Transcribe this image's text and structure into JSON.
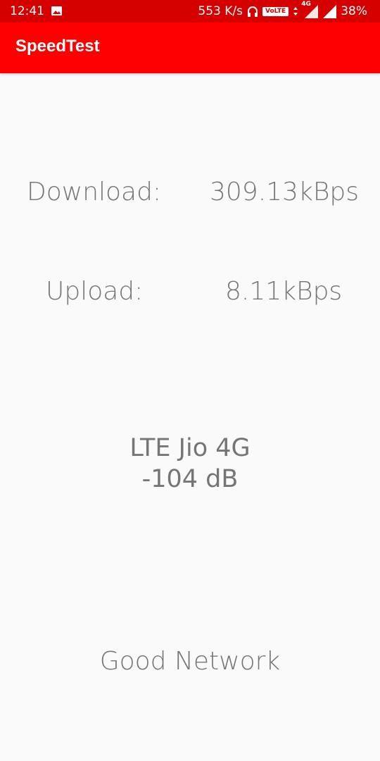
{
  "status_bar": {
    "time": "12:41",
    "speed": "553 K/s",
    "volte": "VoLTE",
    "network_type": "4G",
    "battery": "38%",
    "bar_color": "#d50000"
  },
  "app_bar": {
    "title": "SpeedTest",
    "color": "#ff0000"
  },
  "main": {
    "download_label": "Download:",
    "download_value": "309.13kBps",
    "upload_label": "Upload:",
    "upload_value": "8.11kBps",
    "network_name": "LTE Jio 4G",
    "signal_strength": "-104 dB",
    "quality": "Good Network"
  }
}
